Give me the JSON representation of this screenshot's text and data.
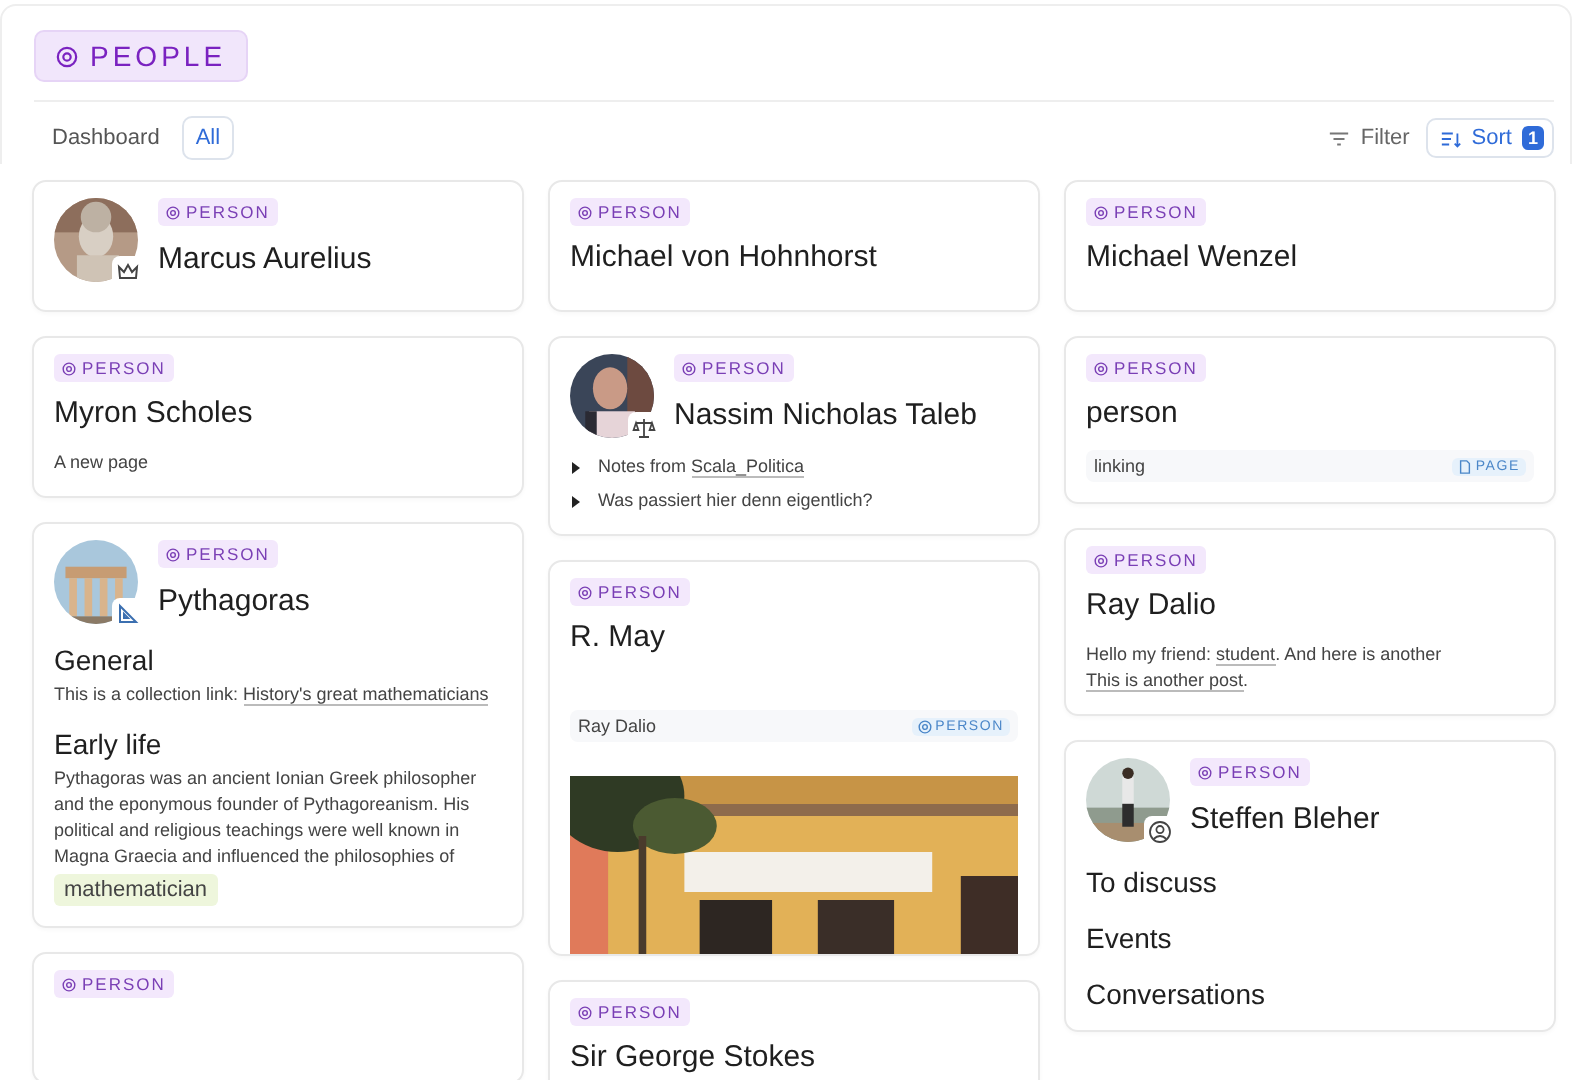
{
  "header": {
    "title": "PEOPLE"
  },
  "views": [
    {
      "label": "Dashboard",
      "selected": false
    },
    {
      "label": "All",
      "selected": true
    }
  ],
  "toolbar": {
    "filter": "Filter",
    "sort": {
      "label": "Sort",
      "count": "1"
    }
  },
  "columns": [
    [
      {
        "tag": "PERSON",
        "title": "Marcus Aurelius",
        "avatar": {
          "kind": "crown"
        }
      },
      {
        "tag": "PERSON",
        "title": "Myron Scholes",
        "blocks": [
          {
            "kind": "paragraph",
            "parts": [
              {
                "text": "A new page"
              }
            ]
          }
        ]
      },
      {
        "tag": "PERSON",
        "title": "Pythagoras",
        "avatar": {
          "kind": "set-square"
        },
        "blocks": [
          {
            "kind": "heading",
            "text": "General"
          },
          {
            "kind": "paragraph",
            "parts": [
              {
                "text": "This is a collection link: "
              },
              {
                "link": "History's great mathematicians"
              }
            ]
          },
          {
            "kind": "heading",
            "text": "Early life"
          },
          {
            "kind": "paragraph",
            "parts": [
              {
                "text": "Pythagoras was an ancient Ionian Greek philosopher and the eponymous founder of Pythagoreanism. His political and religious teachings were well known in Magna Graecia and influenced the philosophies of"
              }
            ]
          },
          {
            "kind": "chip",
            "text": "mathematician"
          }
        ]
      },
      {
        "tag": "PERSON"
      }
    ],
    [
      {
        "tag": "PERSON",
        "title": "Michael von Hohnhorst"
      },
      {
        "tag": "PERSON",
        "title": "Nassim Nicholas Taleb",
        "avatar": {
          "kind": "scales"
        },
        "blocks": [
          {
            "kind": "bullets",
            "items": [
              {
                "parts": [
                  {
                    "text": "Notes from "
                  },
                  {
                    "link": "Scala_Politica"
                  }
                ]
              },
              {
                "parts": [
                  {
                    "text": "Was passiert hier denn eigentlich?"
                  }
                ]
              }
            ]
          }
        ]
      },
      {
        "tag": "PERSON",
        "title": "R. May",
        "blocks": [
          {
            "kind": "mention",
            "label": "Ray Dalio",
            "tag": {
              "kind": "person",
              "label": "PERSON"
            }
          },
          {
            "kind": "picture"
          }
        ]
      },
      {
        "tag": "PERSON",
        "title": "Sir George Stokes"
      }
    ],
    [
      {
        "tag": "PERSON",
        "title": "Michael Wenzel"
      },
      {
        "tag": "PERSON",
        "title": "person",
        "blocks": [
          {
            "kind": "mention",
            "label": "linking",
            "tag": {
              "kind": "page",
              "label": "PAGE"
            }
          }
        ]
      },
      {
        "tag": "PERSON",
        "title": "Ray Dalio",
        "blocks": [
          {
            "kind": "paragraph",
            "parts": [
              {
                "text": "Hello my friend: "
              },
              {
                "link": "student"
              },
              {
                "text": ". And here is another "
              },
              {
                "link": "This is another post"
              },
              {
                "text": "."
              }
            ]
          }
        ]
      },
      {
        "tag": "PERSON",
        "title": "Steffen Bleher",
        "avatar": {
          "kind": "person"
        },
        "blocks": [
          {
            "kind": "heading",
            "text": "To discuss"
          },
          {
            "kind": "heading",
            "text": "Events"
          },
          {
            "kind": "heading",
            "text": "Conversations"
          }
        ]
      }
    ]
  ]
}
